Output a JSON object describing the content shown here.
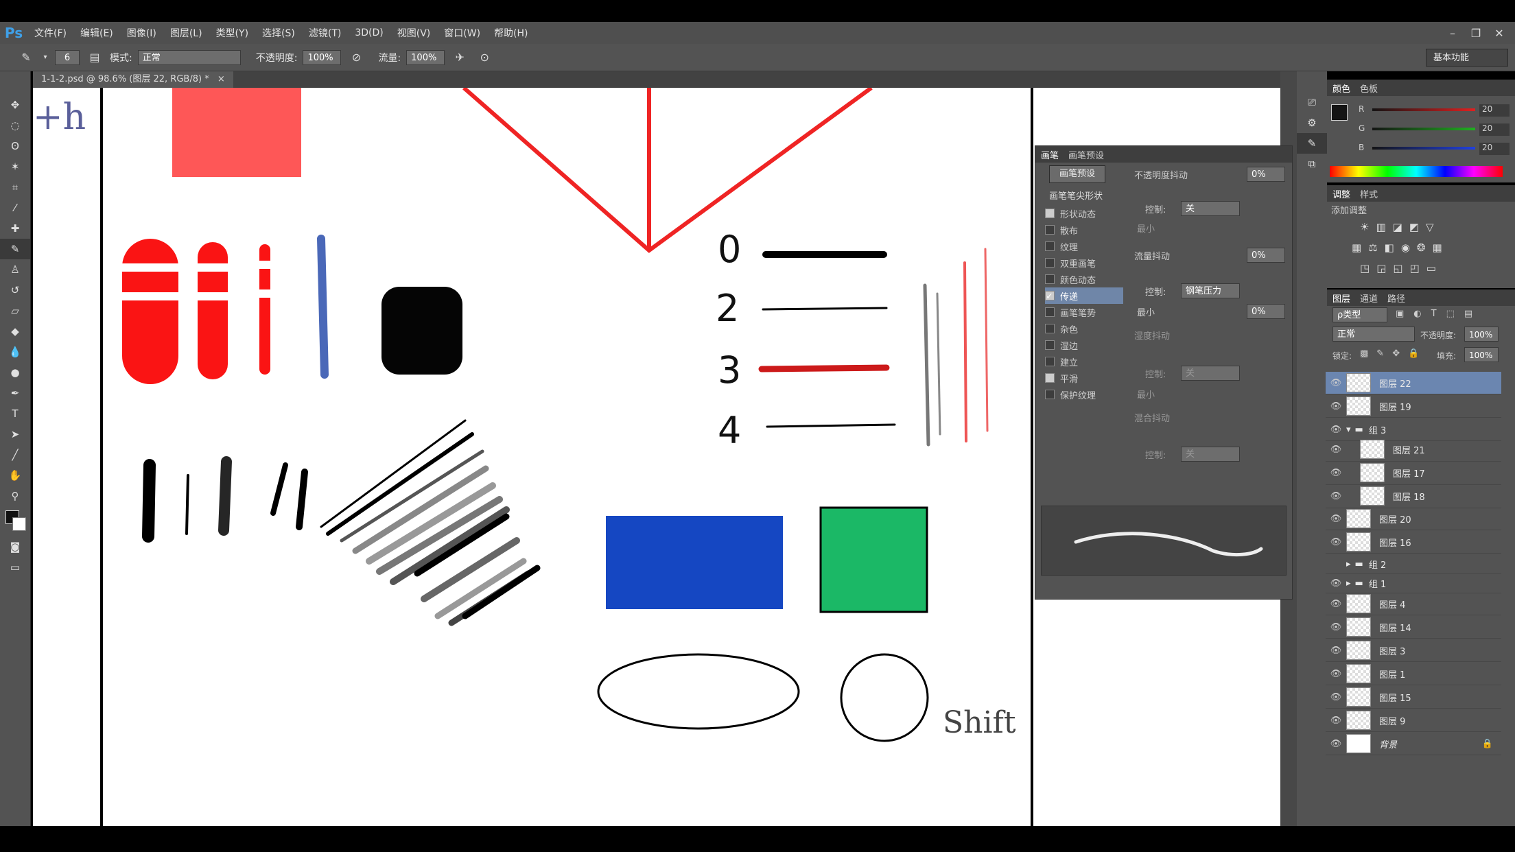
{
  "app": {
    "logo": "Ps"
  },
  "menu": [
    "文件(F)",
    "编辑(E)",
    "图像(I)",
    "图层(L)",
    "类型(Y)",
    "选择(S)",
    "滤镜(T)",
    "3D(D)",
    "视图(V)",
    "窗口(W)",
    "帮助(H)"
  ],
  "window_controls": [
    "–",
    "❐",
    "✕"
  ],
  "options": {
    "size_value": "6",
    "mode_label": "模式:",
    "mode_value": "正常",
    "opacity_label": "不透明度:",
    "opacity_value": "100%",
    "flow_label": "流量:",
    "flow_value": "100%",
    "workspace": "基本功能"
  },
  "document": {
    "tab_title": "1-1-2.psd @ 98.6% (图层 22, RGB/8) *",
    "close": "×"
  },
  "canvas": {
    "hint_text": "+h",
    "shift_text": "Shift",
    "numbers": [
      "0",
      "2",
      "3",
      "4"
    ],
    "colors": {
      "red": "#fe5757",
      "brush_red": "#fa1414",
      "blue": "#1547c2",
      "green": "#1bb866",
      "stroke_blue": "#4a68b8"
    }
  },
  "brush_panel": {
    "tabs": [
      "画笔",
      "画笔预设"
    ],
    "preset_button": "画笔预设",
    "tip_shape": "画笔笔尖形状",
    "options": [
      {
        "label": "形状动态",
        "checked": true
      },
      {
        "label": "散布",
        "checked": false
      },
      {
        "label": "纹理",
        "checked": false
      },
      {
        "label": "双重画笔",
        "checked": false
      },
      {
        "label": "颜色动态",
        "checked": false
      },
      {
        "label": "传递",
        "checked": true,
        "active": true
      },
      {
        "label": "画笔笔势",
        "checked": false
      },
      {
        "label": "杂色",
        "checked": false
      },
      {
        "label": "湿边",
        "checked": false
      },
      {
        "label": "建立",
        "checked": false
      },
      {
        "label": "平滑",
        "checked": true
      },
      {
        "label": "保护纹理",
        "checked": false
      }
    ],
    "opacity_jitter": {
      "label": "不透明度抖动",
      "value": "0%"
    },
    "control_label": "控制:",
    "control_off": "关",
    "min_label": "最小",
    "flow_jitter": {
      "label": "流量抖动",
      "value": "0%"
    },
    "pen_pressure": "钢笔压力",
    "flow_min_value": "0%",
    "wet_jitter": "湿度抖动",
    "mix_jitter": "混合抖动"
  },
  "color_panel": {
    "tabs": [
      "颜色",
      "色板"
    ],
    "channels": [
      {
        "name": "R",
        "value": "20",
        "color": "#e02020"
      },
      {
        "name": "G",
        "value": "20",
        "color": "#20b020"
      },
      {
        "name": "B",
        "value": "20",
        "color": "#2040e0"
      }
    ]
  },
  "adjust_panel": {
    "tabs": [
      "调整",
      "样式"
    ],
    "title": "添加调整"
  },
  "layers_panel": {
    "tabs": [
      "图层",
      "通道",
      "路径"
    ],
    "filter_label": "ρ类型",
    "blend_mode": "正常",
    "opacity_label": "不透明度:",
    "opacity_value": "100%",
    "lock_label": "锁定:",
    "fill_label": "填充:",
    "fill_value": "100%",
    "layers": [
      {
        "name": "图层 22",
        "selected": true
      },
      {
        "name": "图层 19"
      },
      {
        "name": "组 3",
        "group": true,
        "open": true
      },
      {
        "name": "图层 21",
        "indent": true
      },
      {
        "name": "图层 17",
        "indent": true
      },
      {
        "name": "图层 18",
        "indent": true
      },
      {
        "name": "图层 20"
      },
      {
        "name": "图层 16"
      },
      {
        "name": "组 2",
        "group": true,
        "hidden": true
      },
      {
        "name": "组 1",
        "group": true
      },
      {
        "name": "图层 4"
      },
      {
        "name": "图层 14"
      },
      {
        "name": "图层 3"
      },
      {
        "name": "图层 1"
      },
      {
        "name": "图层 15"
      },
      {
        "name": "图层 9"
      },
      {
        "name": "背景",
        "background": true
      }
    ]
  }
}
